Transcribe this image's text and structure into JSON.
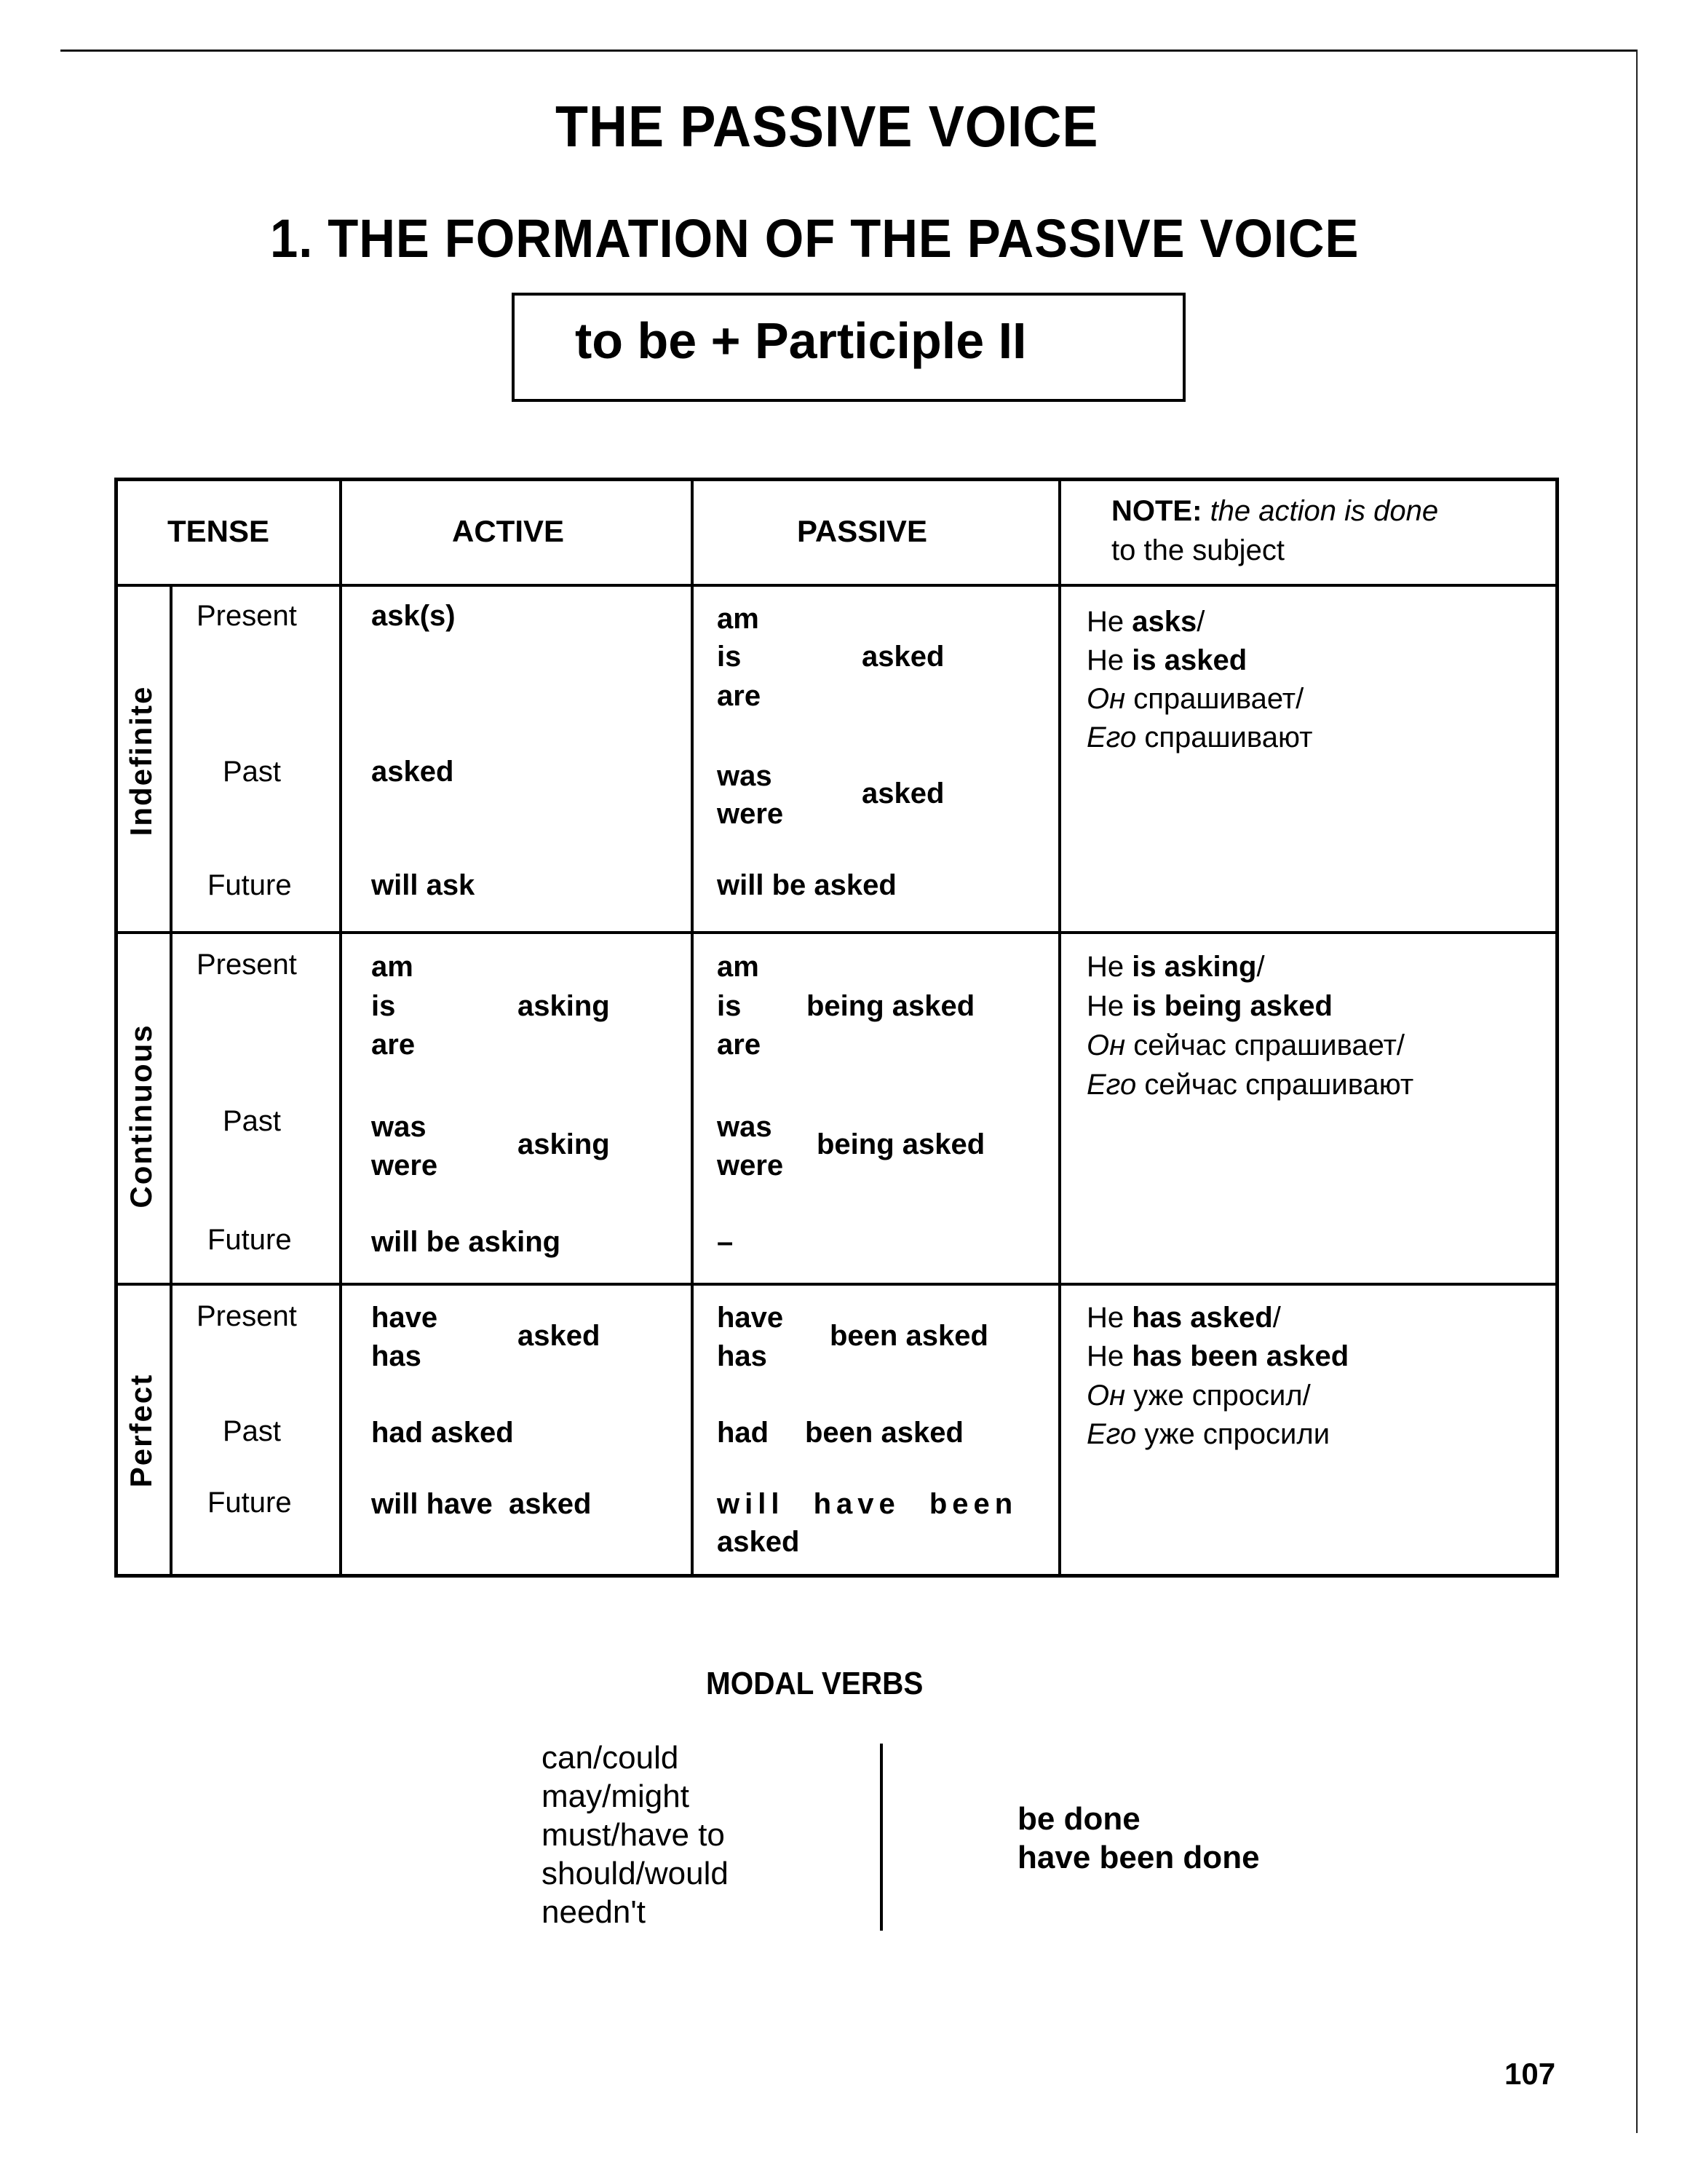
{
  "page": {
    "title": "THE PASSIVE VOICE",
    "section_title": "1. THE FORMATION OF THE PASSIVE VOICE",
    "formula": "to be + Participle II",
    "page_number": "107"
  },
  "table": {
    "headers": {
      "tense": "TENSE",
      "active": "ACTIVE",
      "passive": "PASSIVE",
      "note_bold": "NOTE:",
      "note_italic": "the action is done",
      "note_line2": "to the subject"
    },
    "groups": [
      {
        "label": "Indefinite",
        "tenses": [
          "Present",
          "Past",
          "Future"
        ],
        "active": {
          "present": "ask(s)",
          "past": "asked",
          "future": "will ask"
        },
        "passive": {
          "present_aux": [
            "am",
            "is",
            "are"
          ],
          "present_main": "asked",
          "past_aux": [
            "was",
            "were"
          ],
          "past_main": "asked",
          "future": "will be asked"
        },
        "example": {
          "line1_plain": "He ",
          "line1_bold": "asks",
          "line1_end": "/",
          "line2_plain": "He ",
          "line2_bold": "is asked",
          "line3_italic": "Он",
          "line3_plain": " спрашивает/",
          "line4_italic": "Его",
          "line4_plain": " спрашивают"
        }
      },
      {
        "label": "Continuous",
        "tenses": [
          "Present",
          "Past",
          "Future"
        ],
        "active": {
          "present_aux": [
            "am",
            "is",
            "are"
          ],
          "present_main": "asking",
          "past_aux": [
            "was",
            "were"
          ],
          "past_main": "asking",
          "future": "will be asking"
        },
        "passive": {
          "present_aux": [
            "am",
            "is",
            "are"
          ],
          "present_main": "being asked",
          "past_aux": [
            "was",
            "were"
          ],
          "past_main": "being asked",
          "future": "–"
        },
        "example": {
          "line1_plain": "He ",
          "line1_bold": "is asking",
          "line1_end": "/",
          "line2_plain": "He ",
          "line2_bold": "is being asked",
          "line3_italic": "Он",
          "line3_plain": " сейчас спрашивает/",
          "line4_italic": "Его",
          "line4_plain": " сейчас спрашивают"
        }
      },
      {
        "label": "Perfect",
        "tenses": [
          "Present",
          "Past",
          "Future"
        ],
        "active": {
          "present_aux": [
            "have",
            "has"
          ],
          "present_main": "asked",
          "past": "had asked",
          "future": "will have  asked"
        },
        "passive": {
          "present_aux": [
            "have",
            "has"
          ],
          "present_main": "been asked",
          "past_aux": "had",
          "past_main": "been asked",
          "future_line1": "will have been",
          "future_line2": "asked"
        },
        "example": {
          "line1_plain": "He ",
          "line1_bold": "has asked",
          "line1_end": "/",
          "line2_plain": "He ",
          "line2_bold": "has been asked",
          "line3_italic": "Он",
          "line3_plain": " уже спросил/",
          "line4_italic": "Его",
          "line4_plain": " уже спросили"
        }
      }
    ]
  },
  "modal": {
    "title": "MODAL VERBS",
    "verbs": [
      "can/could",
      "may/might",
      "must/have to",
      "should/would",
      "needn't"
    ],
    "forms": [
      "be done",
      "have been done"
    ]
  }
}
